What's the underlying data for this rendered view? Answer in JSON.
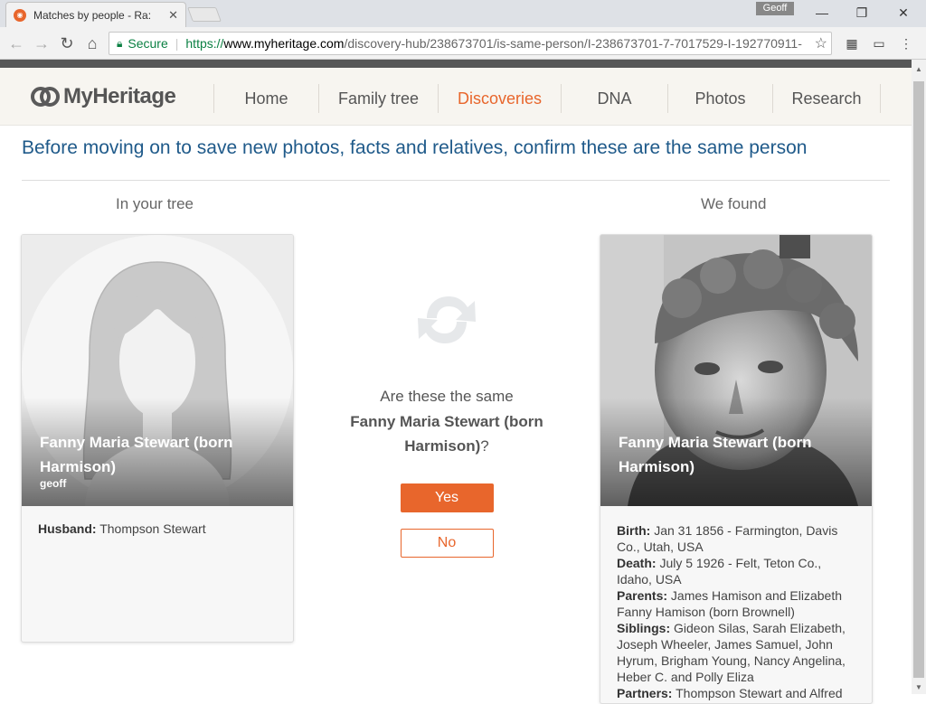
{
  "browser": {
    "tab_title": "Matches by people - Ra:",
    "profile": "Geoff",
    "secure_label": "Secure",
    "url_scheme": "https://",
    "url_host": "www.myheritage.com",
    "url_path": "/discovery-hub/238673701/is-same-person/I-238673701-7-7017529-I-192770911-"
  },
  "site": {
    "brand": "MyHeritage",
    "nav": [
      "Home",
      "Family tree",
      "Discoveries",
      "DNA",
      "Photos",
      "Research"
    ],
    "active_nav": "Discoveries",
    "brand_color": "#e8662c"
  },
  "page": {
    "heading": "Before moving on to save new photos, facts and relatives, confirm these are the same person",
    "left_label": "In your tree",
    "right_label": "We found",
    "question": "Are these the same",
    "question_name": "Fanny Maria Stewart (born Harmison)",
    "question_mark": "?",
    "yes_label": "Yes",
    "no_label": "No"
  },
  "tree_person": {
    "name": "Fanny Maria Stewart (born Harmison)",
    "added_by": "geoff",
    "husband_label": "Husband:",
    "husband": "Thompson Stewart"
  },
  "found_person": {
    "name": "Fanny Maria Stewart (born Harmison)",
    "facts": [
      {
        "label": "Birth:",
        "value": "Jan 31 1856 - Farmington, Davis Co., Utah, USA"
      },
      {
        "label": "Death:",
        "value": "July 5 1926 - Felt, Teton Co., Idaho, USA"
      },
      {
        "label": "Parents:",
        "value": "James Hamison and Elizabeth Fanny Hamison (born Brownell)"
      },
      {
        "label": "Siblings:",
        "value": "Gideon Silas, Sarah Elizabeth, Joseph Wheeler, James Samuel, John Hyrum, Brigham Young, Nancy Angelina, Heber C. and Polly Eliza"
      },
      {
        "label": "Partners:",
        "value": "Thompson Stewart and Alfred"
      }
    ]
  }
}
